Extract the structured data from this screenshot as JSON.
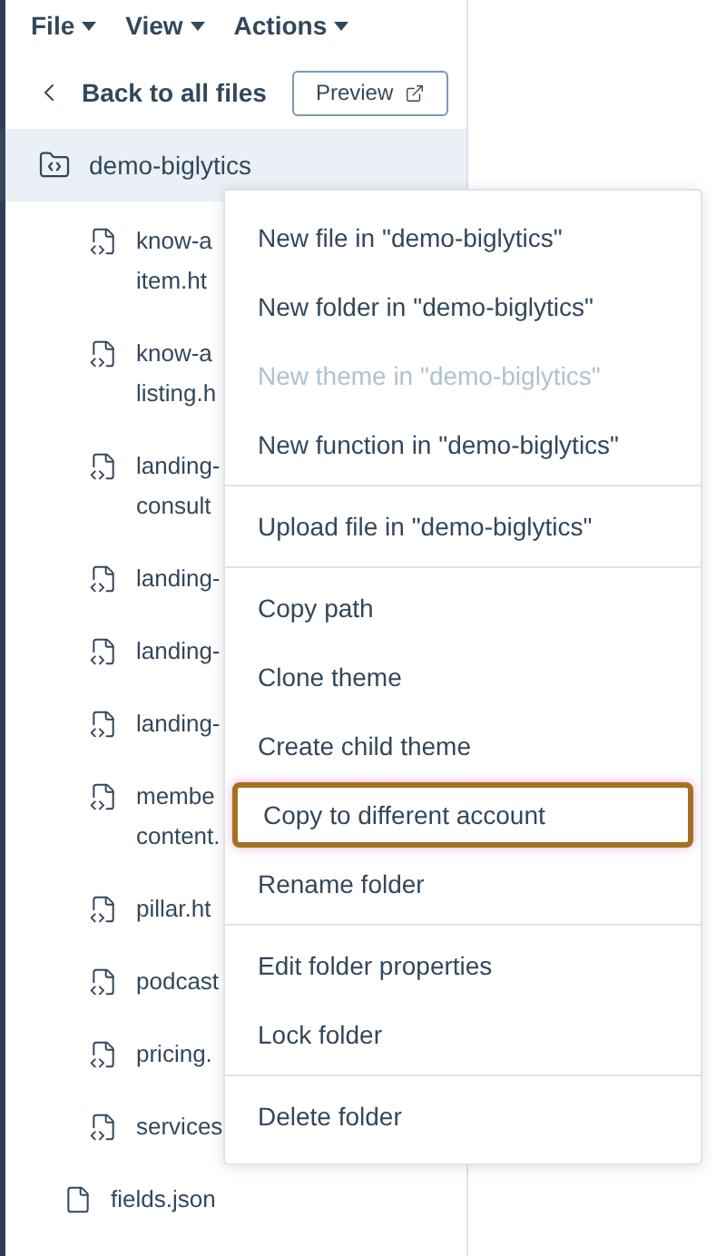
{
  "menu_bar": [
    {
      "label": "File"
    },
    {
      "label": "View"
    },
    {
      "label": "Actions"
    }
  ],
  "back_link": {
    "label": "Back to all files"
  },
  "preview_button": {
    "label": "Preview"
  },
  "tree": {
    "label": "demo-biglytics",
    "selected": true,
    "children": [
      {
        "kind": "code",
        "lines": [
          "know-a",
          "item.ht"
        ]
      },
      {
        "kind": "code",
        "lines": [
          "know-a",
          "listing.h"
        ]
      },
      {
        "kind": "code",
        "lines": [
          "landing-",
          "consult"
        ]
      },
      {
        "kind": "code",
        "lines": [
          "landing-"
        ]
      },
      {
        "kind": "code",
        "lines": [
          "landing-"
        ]
      },
      {
        "kind": "code",
        "lines": [
          "landing-"
        ]
      },
      {
        "kind": "code",
        "lines": [
          "membe",
          "content."
        ]
      },
      {
        "kind": "code",
        "lines": [
          "pillar.ht"
        ]
      },
      {
        "kind": "code",
        "lines": [
          "podcast"
        ]
      },
      {
        "kind": "code",
        "lines": [
          "pricing."
        ]
      },
      {
        "kind": "code",
        "lines": [
          "services"
        ]
      }
    ]
  },
  "root_files": [
    {
      "kind": "json",
      "lines": [
        "fields.json"
      ]
    }
  ],
  "context_menu": {
    "sections": [
      [
        {
          "label": "New file in \"demo-biglytics\"",
          "disabled": false,
          "highlighted": false
        },
        {
          "label": "New folder in \"demo-biglytics\"",
          "disabled": false,
          "highlighted": false
        },
        {
          "label": "New theme in \"demo-biglytics\"",
          "disabled": true,
          "highlighted": false
        },
        {
          "label": "New function in \"demo-biglytics\"",
          "disabled": false,
          "highlighted": false
        }
      ],
      [
        {
          "label": "Upload file in \"demo-biglytics\"",
          "disabled": false,
          "highlighted": false
        }
      ],
      [
        {
          "label": "Copy path",
          "disabled": false,
          "highlighted": false
        },
        {
          "label": "Clone theme",
          "disabled": false,
          "highlighted": false
        },
        {
          "label": "Create child theme",
          "disabled": false,
          "highlighted": false
        },
        {
          "label": "Copy to different account",
          "disabled": false,
          "highlighted": true
        },
        {
          "label": "Rename folder",
          "disabled": false,
          "highlighted": false
        }
      ],
      [
        {
          "label": "Edit folder properties",
          "disabled": false,
          "highlighted": false
        },
        {
          "label": "Lock folder",
          "disabled": false,
          "highlighted": false
        }
      ],
      [
        {
          "label": "Delete folder",
          "disabled": false,
          "highlighted": false
        }
      ]
    ]
  }
}
